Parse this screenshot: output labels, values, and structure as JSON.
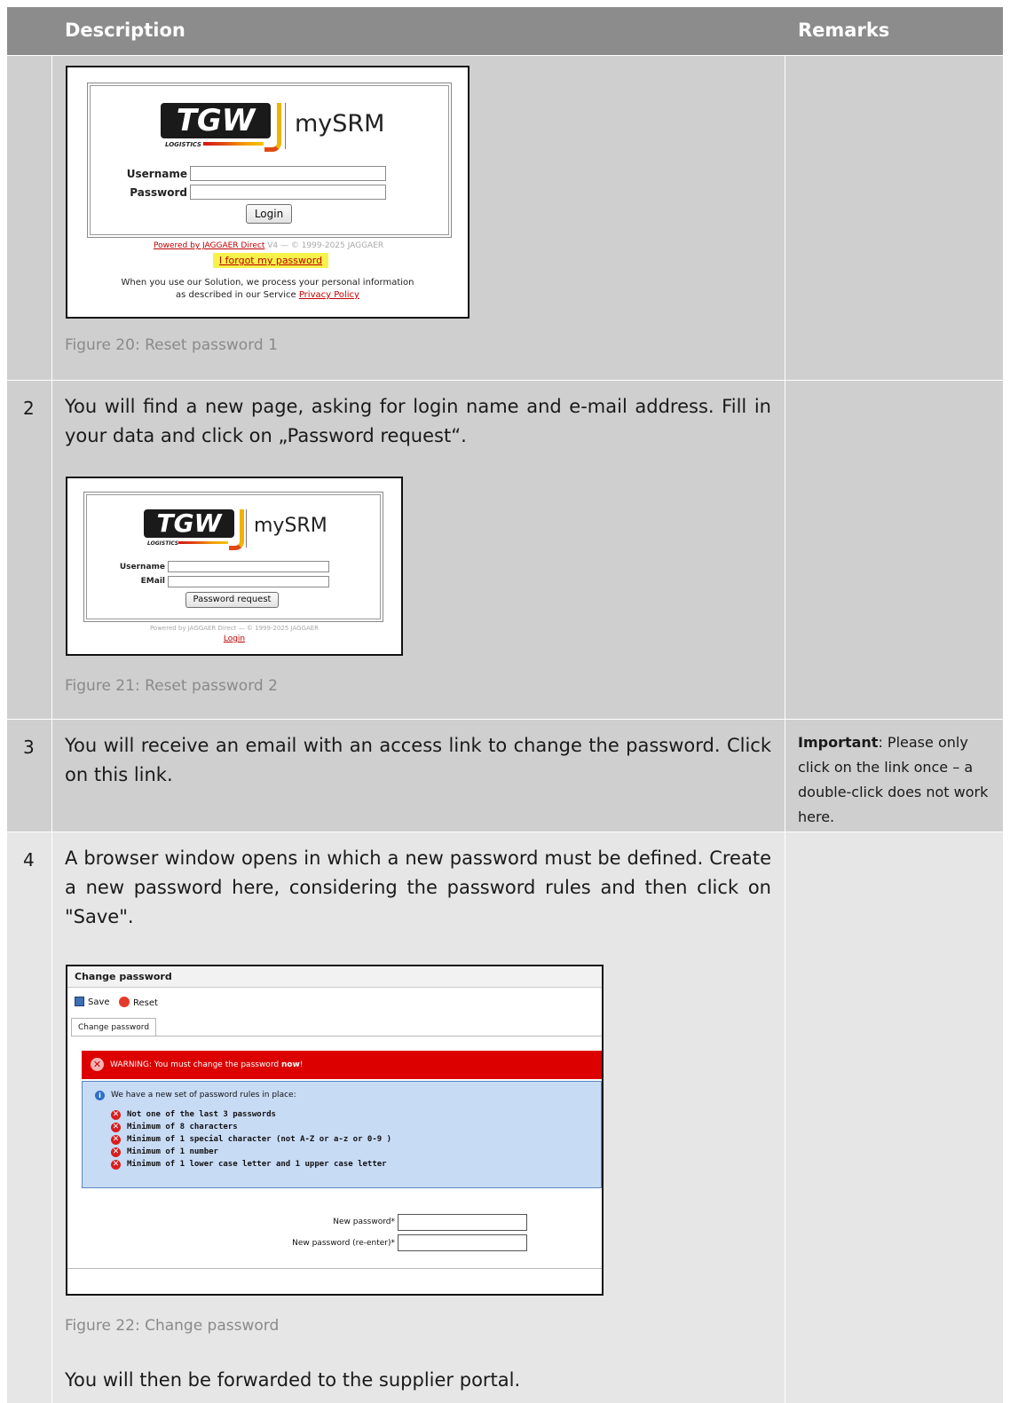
{
  "table_header": {
    "description": "Description",
    "remarks": "Remarks"
  },
  "row1": {
    "figure_caption": "Figure 20: Reset password 1",
    "login": {
      "logo_text": "TGW",
      "logo_sub": "LOGISTICS",
      "brand": "mySRM",
      "username_label": "Username",
      "password_label": "Password",
      "login_button": "Login",
      "powered_link": "Powered by JAGGAER Direct",
      "powered_rest": " V4 — © 1999-2025 JAGGAER",
      "forgot_link": "I forgot my password",
      "privacy_line1": "When you use our Solution, we process your personal information",
      "privacy_line2": "as described in our Service ",
      "privacy_link": "Privacy Policy"
    }
  },
  "row2": {
    "number": "2",
    "text": "You will find a new page, asking for login name and e-mail address. Fill in your data and click on „Password request“.",
    "figure_caption": "Figure 21: Reset password 2",
    "request": {
      "logo_text": "TGW",
      "logo_sub": "LOGISTICS",
      "brand": "mySRM",
      "username_label": "Username",
      "email_label": "EMail",
      "request_button": "Password request",
      "powered": "Powered by JAGGAER Direct — © 1999-2025 JAGGAER",
      "login_link": "Login"
    }
  },
  "row3": {
    "number": "3",
    "text": "You will receive an email with an access link to change the password. Click on this link.",
    "remark_bold": "Important",
    "remark_text": ": Please only click on the link once – a double-click does not work here."
  },
  "row4": {
    "number": "4",
    "text": "A browser window opens in which a new password must be defined. Create a new password here, considering the password rules and then click on \"Save\".",
    "figure_caption": "Figure 22: Change password",
    "after_text": "You will then be forwarded to the supplier portal.",
    "change_password": {
      "title": "Change password",
      "save": "Save",
      "reset": "Reset",
      "tab": "Change password",
      "warning_prefix": "WARNING: You must change the password ",
      "warning_bold": "now",
      "warning_suffix": "!",
      "info_head": "We have a new set of password rules in place:",
      "rules": [
        "Not one of the last 3 passwords",
        "Minimum of 8 characters",
        "Minimum of 1 special character (not A-Z or a-z or 0-9 )",
        "Minimum of 1 number",
        "Minimum of 1 lower case letter and 1 upper case letter"
      ],
      "new_password_label": "New password*",
      "reenter_label": "New password (re-enter)*"
    }
  }
}
